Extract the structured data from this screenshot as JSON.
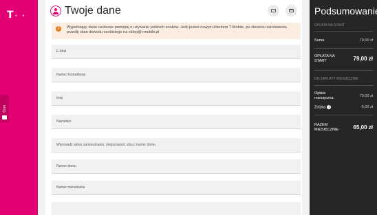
{
  "brand": {
    "logo": "T",
    "logo_dots": "· ·",
    "color": "#e20074"
  },
  "sidebar": {
    "home_label": "Dom"
  },
  "header": {
    "title": "Twoje dane"
  },
  "notice": {
    "text": "Wypełniając dane osobowe pamiętaj o używaniu polskich znaków. Jeśli jesteś nowym klientem T-Mobile, po złożeniu zamówienia prześlij skan dowodu osobistego na sklep@t-mobile.pl"
  },
  "form": {
    "fields": [
      {
        "label": "E-Mail"
      },
      {
        "label": "Numer Kontaktowy"
      },
      {
        "label": "Imię"
      },
      {
        "label": "Nazwisko"
      },
      {
        "label": "Wprowadź adres zamieszkania: miejscowość ulica i numer domu"
      },
      {
        "label": "Numer domu"
      },
      {
        "label": "Numer mieszkania"
      },
      {
        "label": ""
      }
    ]
  },
  "summary": {
    "title": "Podsumowanie",
    "start_section": "OPŁATA NA START",
    "sum_label": "Suma",
    "sum_value": "79,00 zł",
    "start_fee_label_1": "OPŁATA NA",
    "start_fee_label_2": "START",
    "start_fee_value": "79,00 zł",
    "monthly_section": "DO ZAPŁATY MIESIĘCZNIE",
    "monthly_fee_label_1": "Opłata",
    "monthly_fee_label_2": "miesięczna",
    "monthly_fee_value": "70,00 zł",
    "discount_label": "Zniżka",
    "discount_value": "-5,00 zł",
    "total_label_1": "RAZEM",
    "total_label_2": "MIESIĘCZNIE",
    "total_value": "65,00 zł"
  }
}
